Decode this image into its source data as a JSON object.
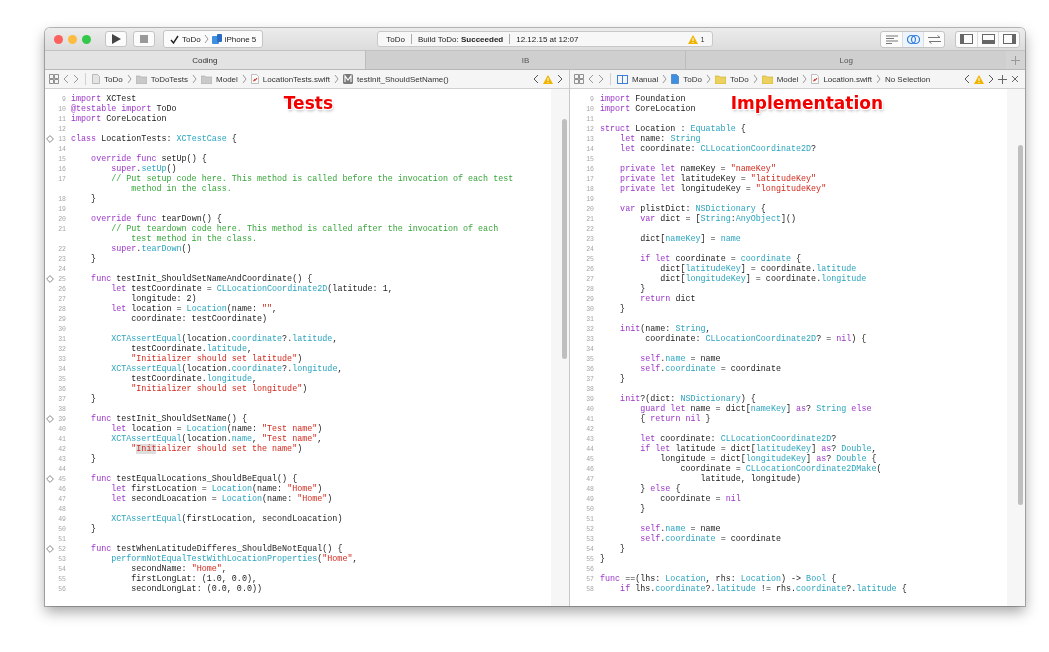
{
  "toolbar": {
    "scheme": {
      "target": "ToDo",
      "device": "iPhone 5"
    },
    "activity": {
      "project": "ToDo",
      "build": "Build ToDo: **Succeeded**",
      "timestamp": "12.12.15 at 12:07",
      "warning_count": "1"
    },
    "editor_modes": [
      {
        "kind": "standard",
        "selected": false
      },
      {
        "kind": "assistant",
        "selected": true
      },
      {
        "kind": "version",
        "selected": false
      }
    ]
  },
  "tabs": [
    {
      "label": "Coding",
      "selected": true
    },
    {
      "label": "IB",
      "selected": false
    },
    {
      "label": "Log",
      "selected": false
    }
  ],
  "panes": [
    {
      "annotation": "Tests",
      "jump_bar": [
        {
          "kind": "file",
          "label": "ToDo"
        },
        {
          "kind": "folder",
          "label": "ToDoTests"
        },
        {
          "kind": "folder",
          "label": "Model"
        },
        {
          "kind": "swift",
          "label": "LocationTests.swift"
        },
        {
          "kind": "method",
          "label": "testInit_ShouldSetName()"
        }
      ],
      "lines": [
        {
          "number": "9",
          "test_marker": false,
          "tokens": [
            {
              "kind": "keyword",
              "text": "import"
            },
            {
              "kind": "plain",
              "text": " XCTest"
            }
          ]
        },
        {
          "number": "10",
          "test_marker": false,
          "tokens": [
            {
              "kind": "keyword",
              "text": "@testable import"
            },
            {
              "kind": "plain",
              "text": " ToDo"
            }
          ]
        },
        {
          "number": "11",
          "test_marker": false,
          "tokens": [
            {
              "kind": "keyword",
              "text": "import"
            },
            {
              "kind": "plain",
              "text": " CoreLocation"
            }
          ]
        },
        {
          "number": "12",
          "test_marker": false
        },
        {
          "number": "13",
          "test_marker": true,
          "tokens": [
            {
              "kind": "keyword",
              "text": "class"
            },
            {
              "kind": "plain",
              "text": " LocationTests: "
            },
            {
              "kind": "type",
              "text": "XCTestCase"
            },
            {
              "kind": "plain",
              "text": " {"
            }
          ]
        },
        {
          "number": "14",
          "test_marker": false
        },
        {
          "number": "15",
          "test_marker": false,
          "tokens": [
            {
              "kind": "keyword",
              "text": "    override func"
            },
            {
              "kind": "plain",
              "text": " setUp() {"
            }
          ]
        },
        {
          "number": "16",
          "test_marker": false,
          "tokens": [
            {
              "kind": "keyword",
              "text": "        super"
            },
            {
              "kind": "plain",
              "text": "."
            },
            {
              "kind": "type",
              "text": "setUp"
            },
            {
              "kind": "plain",
              "text": "()"
            }
          ]
        },
        {
          "number": "17",
          "test_marker": false,
          "tokens": [
            {
              "kind": "comment",
              "text": "        // Put setup code here. This method is called before the invocation of each test"
            }
          ]
        },
        {
          "test_marker": false,
          "tokens": [
            {
              "kind": "comment",
              "text": "            method in the class."
            }
          ]
        },
        {
          "number": "18",
          "test_marker": false,
          "tokens": [
            {
              "kind": "plain",
              "text": "    }"
            }
          ]
        },
        {
          "number": "19",
          "test_marker": false
        },
        {
          "number": "20",
          "test_marker": false,
          "tokens": [
            {
              "kind": "keyword",
              "text": "    override func"
            },
            {
              "kind": "plain",
              "text": " tearDown() {"
            }
          ]
        },
        {
          "number": "21",
          "test_marker": false,
          "tokens": [
            {
              "kind": "comment",
              "text": "        // Put teardown code here. This method is called after the invocation of each"
            }
          ]
        },
        {
          "test_marker": false,
          "tokens": [
            {
              "kind": "comment",
              "text": "            test method in the class."
            }
          ]
        },
        {
          "number": "22",
          "test_marker": false,
          "tokens": [
            {
              "kind": "keyword",
              "text": "        super"
            },
            {
              "kind": "plain",
              "text": "."
            },
            {
              "kind": "type",
              "text": "tearDown"
            },
            {
              "kind": "plain",
              "text": "()"
            }
          ]
        },
        {
          "number": "23",
          "test_marker": false,
          "tokens": [
            {
              "kind": "plain",
              "text": "    }"
            }
          ]
        },
        {
          "number": "24",
          "test_marker": false
        },
        {
          "number": "25",
          "test_marker": true,
          "tokens": [
            {
              "kind": "keyword",
              "text": "    func"
            },
            {
              "kind": "plain",
              "text": " testInit_ShouldSetNameAndCoordinate() {"
            }
          ]
        },
        {
          "number": "26",
          "test_marker": false,
          "tokens": [
            {
              "kind": "keyword",
              "text": "        let"
            },
            {
              "kind": "plain",
              "text": " testCoordinate = "
            },
            {
              "kind": "type",
              "text": "CLLocationCoordinate2D"
            },
            {
              "kind": "plain",
              "text": "(latitude: 1,"
            }
          ]
        },
        {
          "number": "27",
          "test_marker": false,
          "tokens": [
            {
              "kind": "plain",
              "text": "            longitude: 2)"
            }
          ]
        },
        {
          "number": "28",
          "test_marker": false,
          "tokens": [
            {
              "kind": "keyword",
              "text": "        let"
            },
            {
              "kind": "plain",
              "text": " location = "
            },
            {
              "kind": "type",
              "text": "Location"
            },
            {
              "kind": "plain",
              "text": "(name: "
            },
            {
              "kind": "string",
              "text": "\"\""
            },
            {
              "kind": "plain",
              "text": ","
            }
          ]
        },
        {
          "number": "29",
          "test_marker": false,
          "tokens": [
            {
              "kind": "plain",
              "text": "            coordinate: testCoordinate)"
            }
          ]
        },
        {
          "number": "30",
          "test_marker": false
        },
        {
          "number": "31",
          "test_marker": false,
          "tokens": [
            {
              "kind": "type",
              "text": "        XCTAssertEqual"
            },
            {
              "kind": "plain",
              "text": "(location."
            },
            {
              "kind": "type",
              "text": "coordinate"
            },
            {
              "kind": "plain",
              "text": "?."
            },
            {
              "kind": "type",
              "text": "latitude"
            },
            {
              "kind": "plain",
              "text": ","
            }
          ]
        },
        {
          "number": "32",
          "test_marker": false,
          "tokens": [
            {
              "kind": "plain",
              "text": "            testCoordinate."
            },
            {
              "kind": "type",
              "text": "latitude"
            },
            {
              "kind": "plain",
              "text": ","
            }
          ]
        },
        {
          "number": "33",
          "test_marker": false,
          "tokens": [
            {
              "kind": "string",
              "text": "            \"Initializer should set latitude\""
            },
            {
              "kind": "plain",
              "text": ")"
            }
          ]
        },
        {
          "number": "34",
          "test_marker": false,
          "tokens": [
            {
              "kind": "type",
              "text": "        XCTAssertEqual"
            },
            {
              "kind": "plain",
              "text": "(location."
            },
            {
              "kind": "type",
              "text": "coordinate"
            },
            {
              "kind": "plain",
              "text": "?."
            },
            {
              "kind": "type",
              "text": "longitude"
            },
            {
              "kind": "plain",
              "text": ","
            }
          ]
        },
        {
          "number": "35",
          "test_marker": false,
          "tokens": [
            {
              "kind": "plain",
              "text": "            testCoordinate."
            },
            {
              "kind": "type",
              "text": "longitude"
            },
            {
              "kind": "plain",
              "text": ","
            }
          ]
        },
        {
          "number": "36",
          "test_marker": false,
          "tokens": [
            {
              "kind": "string",
              "text": "            \"Initializer should set longitude\""
            },
            {
              "kind": "plain",
              "text": ")"
            }
          ]
        },
        {
          "number": "37",
          "test_marker": false,
          "tokens": [
            {
              "kind": "plain",
              "text": "    }"
            }
          ]
        },
        {
          "number": "38",
          "test_marker": false
        },
        {
          "number": "39",
          "test_marker": true,
          "tokens": [
            {
              "kind": "keyword",
              "text": "    func"
            },
            {
              "kind": "plain",
              "text": " testInit_ShouldSetName() {"
            }
          ]
        },
        {
          "number": "40",
          "test_marker": false,
          "tokens": [
            {
              "kind": "keyword",
              "text": "        let"
            },
            {
              "kind": "plain",
              "text": " location = "
            },
            {
              "kind": "type",
              "text": "Location"
            },
            {
              "kind": "plain",
              "text": "(name: "
            },
            {
              "kind": "string",
              "text": "\"Test name\""
            },
            {
              "kind": "plain",
              "text": ")"
            }
          ]
        },
        {
          "number": "41",
          "test_marker": false,
          "tokens": [
            {
              "kind": "type",
              "text": "        XCTAssertEqual"
            },
            {
              "kind": "plain",
              "text": "(location."
            },
            {
              "kind": "type",
              "text": "name"
            },
            {
              "kind": "plain",
              "text": ", "
            },
            {
              "kind": "string",
              "text": "\"Test name\""
            },
            {
              "kind": "plain",
              "text": ","
            }
          ]
        },
        {
          "number": "42",
          "test_marker": false,
          "tokens": [
            {
              "kind": "string",
              "text": "            \""
            },
            {
              "kind": "match",
              "text": "Init"
            },
            {
              "kind": "string",
              "text": "ializer should set the name\""
            },
            {
              "kind": "plain",
              "text": ")"
            }
          ]
        },
        {
          "number": "43",
          "test_marker": false,
          "tokens": [
            {
              "kind": "plain",
              "text": "    }"
            }
          ]
        },
        {
          "number": "44",
          "test_marker": false
        },
        {
          "number": "45",
          "test_marker": true,
          "tokens": [
            {
              "kind": "keyword",
              "text": "    func"
            },
            {
              "kind": "plain",
              "text": " testEqualLocations_ShouldBeEqual() {"
            }
          ]
        },
        {
          "number": "46",
          "test_marker": false,
          "tokens": [
            {
              "kind": "keyword",
              "text": "        let"
            },
            {
              "kind": "plain",
              "text": " firstLocation = "
            },
            {
              "kind": "type",
              "text": "Location"
            },
            {
              "kind": "plain",
              "text": "(name: "
            },
            {
              "kind": "string",
              "text": "\"Home\""
            },
            {
              "kind": "plain",
              "text": ")"
            }
          ]
        },
        {
          "number": "47",
          "test_marker": false,
          "tokens": [
            {
              "kind": "keyword",
              "text": "        let"
            },
            {
              "kind": "plain",
              "text": " secondLoacation = "
            },
            {
              "kind": "type",
              "text": "Location"
            },
            {
              "kind": "plain",
              "text": "(name: "
            },
            {
              "kind": "string",
              "text": "\"Home\""
            },
            {
              "kind": "plain",
              "text": ")"
            }
          ]
        },
        {
          "number": "48",
          "test_marker": false
        },
        {
          "number": "49",
          "test_marker": false,
          "tokens": [
            {
              "kind": "type",
              "text": "        XCTAssertEqual"
            },
            {
              "kind": "plain",
              "text": "(firstLocation, secondLoacation)"
            }
          ]
        },
        {
          "number": "50",
          "test_marker": false,
          "tokens": [
            {
              "kind": "plain",
              "text": "    }"
            }
          ]
        },
        {
          "number": "51",
          "test_marker": false
        },
        {
          "number": "52",
          "test_marker": true,
          "tokens": [
            {
              "kind": "keyword",
              "text": "    func"
            },
            {
              "kind": "plain",
              "text": " testWhenLatitudeDifferes_ShouldBeNotEqual() {"
            }
          ]
        },
        {
          "number": "53",
          "test_marker": false,
          "tokens": [
            {
              "kind": "type",
              "text": "        performNotEqualTestWithLocationProperties"
            },
            {
              "kind": "plain",
              "text": "("
            },
            {
              "kind": "string",
              "text": "\"Home\""
            },
            {
              "kind": "plain",
              "text": ","
            }
          ]
        },
        {
          "number": "54",
          "test_marker": false,
          "tokens": [
            {
              "kind": "plain",
              "text": "            secondName: "
            },
            {
              "kind": "string",
              "text": "\"Home\""
            },
            {
              "kind": "plain",
              "text": ","
            }
          ]
        },
        {
          "number": "55",
          "test_marker": false,
          "tokens": [
            {
              "kind": "plain",
              "text": "            firstLongLat: (1.0, 0.0),"
            }
          ]
        },
        {
          "number": "56",
          "test_marker": false,
          "tokens": [
            {
              "kind": "plain",
              "text": "            secondLongLat: (0.0, 0.0))"
            }
          ]
        }
      ]
    },
    {
      "annotation": "Implementation",
      "jump_bar": [
        {
          "kind": "manual",
          "label": "Manual"
        },
        {
          "kind": "project",
          "label": "ToDo"
        },
        {
          "kind": "group",
          "label": "ToDo"
        },
        {
          "kind": "group",
          "label": "Model"
        },
        {
          "kind": "swift",
          "label": "Location.swift"
        },
        {
          "kind": "none",
          "label": "No Selection"
        }
      ],
      "lines": [
        {
          "number": "9",
          "tokens": [
            {
              "kind": "keyword",
              "text": "import"
            },
            {
              "kind": "plain",
              "text": " Foundation"
            }
          ]
        },
        {
          "number": "10",
          "tokens": [
            {
              "kind": "keyword",
              "text": "import"
            },
            {
              "kind": "plain",
              "text": " CoreLocation"
            }
          ]
        },
        {
          "number": "11"
        },
        {
          "number": "12",
          "tokens": [
            {
              "kind": "keyword",
              "text": "struct"
            },
            {
              "kind": "plain",
              "text": " Location : "
            },
            {
              "kind": "type",
              "text": "Equatable"
            },
            {
              "kind": "plain",
              "text": " {"
            }
          ]
        },
        {
          "number": "13",
          "tokens": [
            {
              "kind": "keyword",
              "text": "    let"
            },
            {
              "kind": "plain",
              "text": " name: "
            },
            {
              "kind": "type",
              "text": "String"
            }
          ]
        },
        {
          "number": "14",
          "tokens": [
            {
              "kind": "keyword",
              "text": "    let"
            },
            {
              "kind": "plain",
              "text": " coordinate: "
            },
            {
              "kind": "type",
              "text": "CLLocationCoordinate2D"
            },
            {
              "kind": "plain",
              "text": "?"
            }
          ]
        },
        {
          "number": "15"
        },
        {
          "number": "16",
          "tokens": [
            {
              "kind": "keyword",
              "text": "    private let"
            },
            {
              "kind": "plain",
              "text": " nameKey = "
            },
            {
              "kind": "string",
              "text": "\"nameKey\""
            }
          ]
        },
        {
          "number": "17",
          "tokens": [
            {
              "kind": "keyword",
              "text": "    private let"
            },
            {
              "kind": "plain",
              "text": " latitudeKey = "
            },
            {
              "kind": "string",
              "text": "\"latitudeKey\""
            }
          ]
        },
        {
          "number": "18",
          "tokens": [
            {
              "kind": "keyword",
              "text": "    private let"
            },
            {
              "kind": "plain",
              "text": " longitudeKey = "
            },
            {
              "kind": "string",
              "text": "\"longitudeKey\""
            }
          ]
        },
        {
          "number": "19"
        },
        {
          "number": "20",
          "tokens": [
            {
              "kind": "keyword",
              "text": "    var"
            },
            {
              "kind": "plain",
              "text": " plistDict: "
            },
            {
              "kind": "type",
              "text": "NSDictionary"
            },
            {
              "kind": "plain",
              "text": " {"
            }
          ]
        },
        {
          "number": "21",
          "tokens": [
            {
              "kind": "keyword",
              "text": "        var"
            },
            {
              "kind": "plain",
              "text": " dict = ["
            },
            {
              "kind": "type",
              "text": "String"
            },
            {
              "kind": "plain",
              "text": ":"
            },
            {
              "kind": "type",
              "text": "AnyObject"
            },
            {
              "kind": "plain",
              "text": "]()"
            }
          ]
        },
        {
          "number": "22"
        },
        {
          "number": "23",
          "tokens": [
            {
              "kind": "plain",
              "text": "        dict["
            },
            {
              "kind": "type",
              "text": "nameKey"
            },
            {
              "kind": "plain",
              "text": "] = "
            },
            {
              "kind": "type",
              "text": "name"
            }
          ]
        },
        {
          "number": "24"
        },
        {
          "number": "25",
          "tokens": [
            {
              "kind": "keyword",
              "text": "        if let"
            },
            {
              "kind": "plain",
              "text": " coordinate = "
            },
            {
              "kind": "type",
              "text": "coordinate"
            },
            {
              "kind": "plain",
              "text": " {"
            }
          ]
        },
        {
          "number": "26",
          "tokens": [
            {
              "kind": "plain",
              "text": "            dict["
            },
            {
              "kind": "type",
              "text": "latitudeKey"
            },
            {
              "kind": "plain",
              "text": "] = coordinate."
            },
            {
              "kind": "type",
              "text": "latitude"
            }
          ]
        },
        {
          "number": "27",
          "tokens": [
            {
              "kind": "plain",
              "text": "            dict["
            },
            {
              "kind": "type",
              "text": "longitudeKey"
            },
            {
              "kind": "plain",
              "text": "] = coordinate."
            },
            {
              "kind": "type",
              "text": "longitude"
            }
          ]
        },
        {
          "number": "28",
          "tokens": [
            {
              "kind": "plain",
              "text": "        }"
            }
          ]
        },
        {
          "number": "29",
          "tokens": [
            {
              "kind": "keyword",
              "text": "        return"
            },
            {
              "kind": "plain",
              "text": " dict"
            }
          ]
        },
        {
          "number": "30",
          "tokens": [
            {
              "kind": "plain",
              "text": "    }"
            }
          ]
        },
        {
          "number": "31"
        },
        {
          "number": "32",
          "tokens": [
            {
              "kind": "keyword",
              "text": "    init"
            },
            {
              "kind": "plain",
              "text": "(name: "
            },
            {
              "kind": "type",
              "text": "String"
            },
            {
              "kind": "plain",
              "text": ","
            }
          ]
        },
        {
          "number": "33",
          "tokens": [
            {
              "kind": "plain",
              "text": "         coordinate: "
            },
            {
              "kind": "type",
              "text": "CLLocationCoordinate2D"
            },
            {
              "kind": "plain",
              "text": "? = "
            },
            {
              "kind": "keyword",
              "text": "nil"
            },
            {
              "kind": "plain",
              "text": ") {"
            }
          ]
        },
        {
          "number": "34"
        },
        {
          "number": "35",
          "tokens": [
            {
              "kind": "keyword",
              "text": "        self"
            },
            {
              "kind": "plain",
              "text": "."
            },
            {
              "kind": "type",
              "text": "name"
            },
            {
              "kind": "plain",
              "text": " = name"
            }
          ]
        },
        {
          "number": "36",
          "tokens": [
            {
              "kind": "keyword",
              "text": "        self"
            },
            {
              "kind": "plain",
              "text": "."
            },
            {
              "kind": "type",
              "text": "coordinate"
            },
            {
              "kind": "plain",
              "text": " = coordinate"
            }
          ]
        },
        {
          "number": "37",
          "tokens": [
            {
              "kind": "plain",
              "text": "    }"
            }
          ]
        },
        {
          "number": "38"
        },
        {
          "number": "39",
          "tokens": [
            {
              "kind": "keyword",
              "text": "    init"
            },
            {
              "kind": "plain",
              "text": "?(dict: "
            },
            {
              "kind": "type",
              "text": "NSDictionary"
            },
            {
              "kind": "plain",
              "text": ") {"
            }
          ]
        },
        {
          "number": "40",
          "tokens": [
            {
              "kind": "keyword",
              "text": "        guard let"
            },
            {
              "kind": "plain",
              "text": " name = dict["
            },
            {
              "kind": "type",
              "text": "nameKey"
            },
            {
              "kind": "plain",
              "text": "] "
            },
            {
              "kind": "keyword",
              "text": "as"
            },
            {
              "kind": "plain",
              "text": "? "
            },
            {
              "kind": "type",
              "text": "String"
            },
            {
              "kind": "keyword",
              "text": " else"
            }
          ]
        },
        {
          "number": "41",
          "tokens": [
            {
              "kind": "plain",
              "text": "        { "
            },
            {
              "kind": "keyword",
              "text": "return nil"
            },
            {
              "kind": "plain",
              "text": " }"
            }
          ]
        },
        {
          "number": "42"
        },
        {
          "number": "43",
          "tokens": [
            {
              "kind": "keyword",
              "text": "        let"
            },
            {
              "kind": "plain",
              "text": " coordinate: "
            },
            {
              "kind": "type",
              "text": "CLLocationCoordinate2D"
            },
            {
              "kind": "plain",
              "text": "?"
            }
          ]
        },
        {
          "number": "44",
          "tokens": [
            {
              "kind": "keyword",
              "text": "        if let"
            },
            {
              "kind": "plain",
              "text": " latitude = dict["
            },
            {
              "kind": "type",
              "text": "latitudeKey"
            },
            {
              "kind": "plain",
              "text": "] "
            },
            {
              "kind": "keyword",
              "text": "as"
            },
            {
              "kind": "plain",
              "text": "? "
            },
            {
              "kind": "type",
              "text": "Double"
            },
            {
              "kind": "plain",
              "text": ","
            }
          ]
        },
        {
          "number": "45",
          "tokens": [
            {
              "kind": "plain",
              "text": "            longitude = dict["
            },
            {
              "kind": "type",
              "text": "longitudeKey"
            },
            {
              "kind": "plain",
              "text": "] "
            },
            {
              "kind": "keyword",
              "text": "as"
            },
            {
              "kind": "plain",
              "text": "? "
            },
            {
              "kind": "type",
              "text": "Double"
            },
            {
              "kind": "plain",
              "text": " {"
            }
          ]
        },
        {
          "number": "46",
          "tokens": [
            {
              "kind": "plain",
              "text": "                coordinate = "
            },
            {
              "kind": "type",
              "text": "CLLocationCoordinate2DMake"
            },
            {
              "kind": "plain",
              "text": "("
            }
          ]
        },
        {
          "number": "47",
          "tokens": [
            {
              "kind": "plain",
              "text": "                    latitude, longitude)"
            }
          ]
        },
        {
          "number": "48",
          "tokens": [
            {
              "kind": "plain",
              "text": "        } "
            },
            {
              "kind": "keyword",
              "text": "else"
            },
            {
              "kind": "plain",
              "text": " {"
            }
          ]
        },
        {
          "number": "49",
          "tokens": [
            {
              "kind": "plain",
              "text": "            coordinate = "
            },
            {
              "kind": "keyword",
              "text": "nil"
            }
          ]
        },
        {
          "number": "50",
          "tokens": [
            {
              "kind": "plain",
              "text": "        }"
            }
          ]
        },
        {
          "number": "51"
        },
        {
          "number": "52",
          "tokens": [
            {
              "kind": "keyword",
              "text": "        self"
            },
            {
              "kind": "plain",
              "text": "."
            },
            {
              "kind": "type",
              "text": "name"
            },
            {
              "kind": "plain",
              "text": " = name"
            }
          ]
        },
        {
          "number": "53",
          "tokens": [
            {
              "kind": "keyword",
              "text": "        self"
            },
            {
              "kind": "plain",
              "text": "."
            },
            {
              "kind": "type",
              "text": "coordinate"
            },
            {
              "kind": "plain",
              "text": " = coordinate"
            }
          ]
        },
        {
          "number": "54",
          "tokens": [
            {
              "kind": "plain",
              "text": "    }"
            }
          ]
        },
        {
          "number": "55",
          "tokens": [
            {
              "kind": "plain",
              "text": "}"
            }
          ]
        },
        {
          "number": "56"
        },
        {
          "number": "57",
          "tokens": [
            {
              "kind": "keyword",
              "text": "func"
            },
            {
              "kind": "plain",
              "text": " ==(lhs: "
            },
            {
              "kind": "type",
              "text": "Location"
            },
            {
              "kind": "plain",
              "text": ", rhs: "
            },
            {
              "kind": "type",
              "text": "Location"
            },
            {
              "kind": "plain",
              "text": ") -> "
            },
            {
              "kind": "type",
              "text": "Bool"
            },
            {
              "kind": "plain",
              "text": " {"
            }
          ]
        },
        {
          "number": "58",
          "tokens": [
            {
              "kind": "keyword",
              "text": "    if"
            },
            {
              "kind": "plain",
              "text": " lhs."
            },
            {
              "kind": "type",
              "text": "coordinate"
            },
            {
              "kind": "plain",
              "text": "?."
            },
            {
              "kind": "type",
              "text": "latitude"
            },
            {
              "kind": "plain",
              "text": " != rhs."
            },
            {
              "kind": "type",
              "text": "coordinate"
            },
            {
              "kind": "plain",
              "text": "?."
            },
            {
              "kind": "type",
              "text": "latitude"
            },
            {
              "kind": "plain",
              "text": " {"
            }
          ]
        }
      ]
    }
  ]
}
